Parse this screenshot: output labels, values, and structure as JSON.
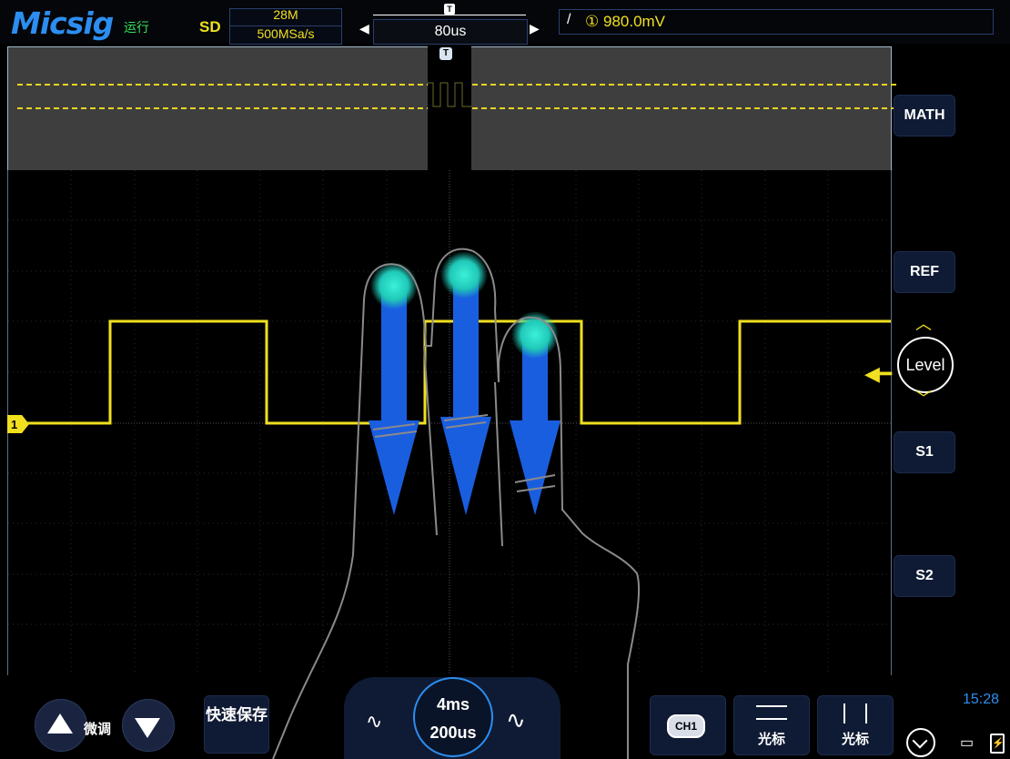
{
  "topbar": {
    "brand": "Micsig",
    "run_status": "运行",
    "mode": "SD",
    "memory_depth": "28M",
    "sample_rate": "500MSa/s",
    "timebase_position": "80us",
    "trigger_channel_glyph": "①",
    "trigger_level": "980.0mV"
  },
  "overview_marker": "T",
  "main_marker": "T",
  "channel": {
    "number": "1",
    "color": "#f0e020"
  },
  "right_panel": {
    "math": "MATH",
    "ref": "REF",
    "level": "Level",
    "s1": "S1",
    "s2": "S2"
  },
  "bottom": {
    "fine_tune": "微调",
    "quick_save": "快速保存",
    "timebase_main": "4ms",
    "timebase_zoom": "200us",
    "ch1_label": "CH1",
    "cursor_h_label": "光标",
    "cursor_v_label": "光标",
    "clock": "15:28"
  },
  "colors": {
    "accent": "#2c8ef0",
    "trace": "#f0e020",
    "button_bg": "#0f1b34"
  },
  "icons": {
    "up": "triangle-up-icon",
    "down": "triangle-down-icon",
    "wave": "sine-wave-icon",
    "menu": "chevron-down-circle-icon",
    "screen": "monitor-icon",
    "battery": "battery-charging-icon",
    "gesture": "three-finger-swipe-down-icon"
  }
}
